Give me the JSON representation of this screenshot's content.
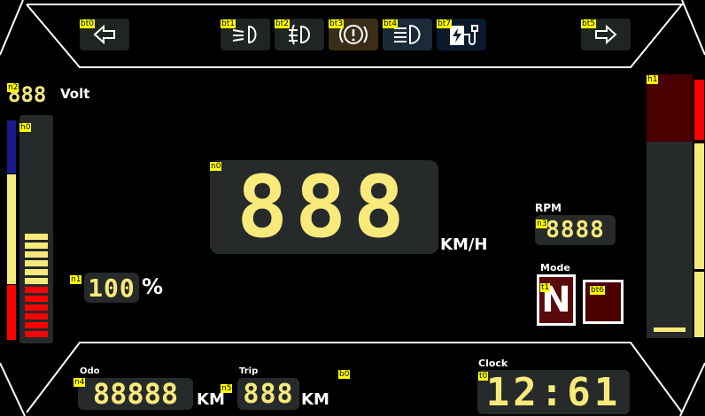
{
  "tags": {
    "bt0": "bt0",
    "bt1": "bt1",
    "bt2": "bt2",
    "bt3": "bt3",
    "bt4": "bt4",
    "bt7": "bt7",
    "bt5": "bt5",
    "n2": "n2",
    "h0": "h0",
    "h1": "h1",
    "n0": "n0",
    "n3": "n3",
    "n1": "n1",
    "t1": "t1",
    "bt6": "bt6",
    "n4": "n4",
    "n5": "n5",
    "b0": "b0",
    "t0": "t0"
  },
  "top": {
    "left_arrow_icon": "arrow-left-icon",
    "right_arrow_icon": "arrow-right-icon",
    "icons": [
      "low-beam-icon",
      "fog-light-icon",
      "brake-warning-icon",
      "high-beam-icon",
      "ev-charging-icon"
    ]
  },
  "voltage": {
    "value": "888",
    "unit": "Volt"
  },
  "speed": {
    "value": "888",
    "unit": "KM/H"
  },
  "rpm": {
    "label": "RPM",
    "value": "8888"
  },
  "battery": {
    "value": "100",
    "unit": "%"
  },
  "mode": {
    "label": "Mode",
    "gear": "N"
  },
  "odo": {
    "label": "Odo",
    "value": "88888",
    "unit": "KM"
  },
  "trip": {
    "label": "Trip",
    "value": "888",
    "unit": "KM"
  },
  "clock": {
    "label": "Clock",
    "value": "12:61"
  },
  "colors": {
    "segment": "#f7ea7a",
    "panel": "#262a2a",
    "red": "#ff0000",
    "dark_red": "#4a0000",
    "yellow": "#f7ea7a",
    "blue": "#1a1a8c"
  }
}
